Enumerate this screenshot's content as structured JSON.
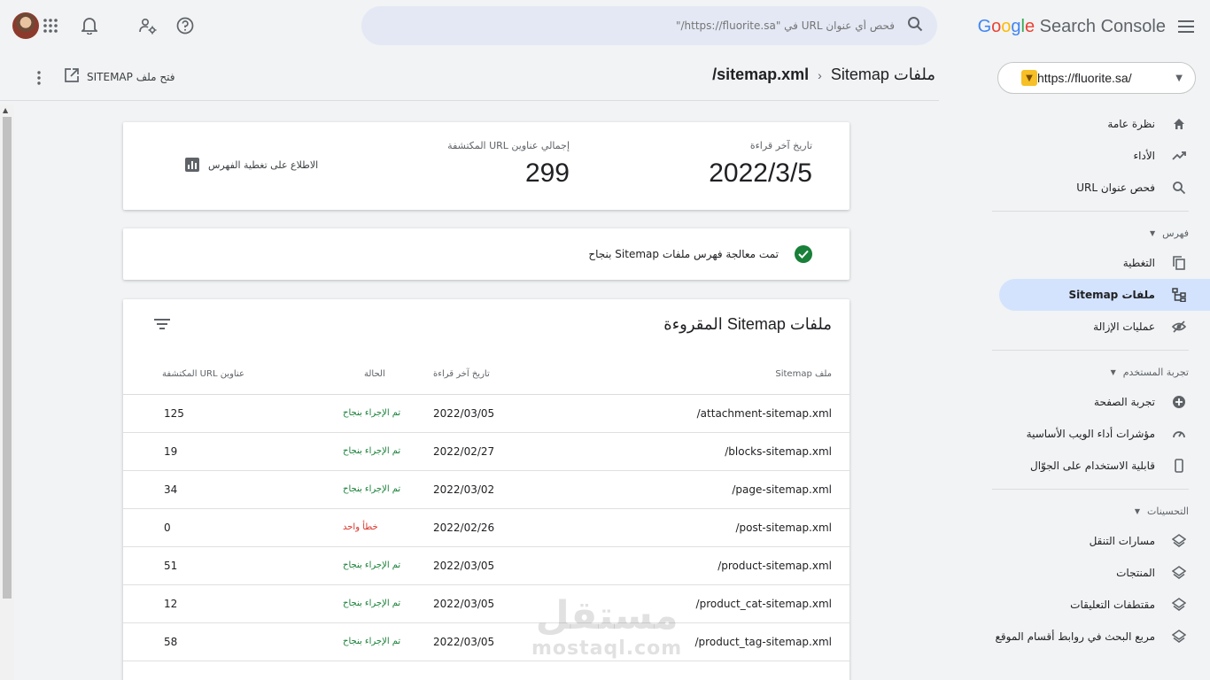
{
  "app": {
    "brand": {
      "G": "G",
      "o1": "o",
      "o2": "o",
      "g": "g",
      "l": "l",
      "e": "e",
      "rest": " Search Console"
    },
    "property_url": "https://fluorite.sa/"
  },
  "search": {
    "placeholder": "فحص أي عنوان URL في \"https://fluorite.sa/\""
  },
  "sidebar": {
    "items_top": [
      {
        "label": "نظرة عامة",
        "icon": "home-icon"
      },
      {
        "label": "الأداء",
        "icon": "trending-icon"
      },
      {
        "label": "فحص عنوان URL",
        "icon": "search-icon"
      }
    ],
    "section_index": "فهرس",
    "items_index": [
      {
        "label": "التغطية",
        "icon": "copy-icon"
      },
      {
        "label": "ملفات Sitemap",
        "icon": "sitemap-icon"
      },
      {
        "label": "عمليات الإزالة",
        "icon": "eye-off-icon"
      }
    ],
    "section_experience": "تجربة المستخدم",
    "items_experience": [
      {
        "label": "تجربة الصفحة",
        "icon": "plus-circle-icon"
      },
      {
        "label": "مؤشرات أداء الويب الأساسية",
        "icon": "gauge-icon"
      },
      {
        "label": "قابلية الاستخدام على الجوّال",
        "icon": "phone-icon"
      }
    ],
    "section_enhancements": "التحسينات",
    "items_enhancements": [
      {
        "label": "مسارات التنقل",
        "icon": "layers-icon"
      },
      {
        "label": "المنتجات",
        "icon": "layers-icon"
      },
      {
        "label": "مقتطفات التعليقات",
        "icon": "layers-icon"
      },
      {
        "label": "مربع البحث في روابط أقسام الموقع",
        "icon": "layers-icon"
      }
    ]
  },
  "header": {
    "breadcrumb_parent": "ملفات Sitemap",
    "breadcrumb_current": "/sitemap.xml",
    "open_sitemap": "فتح ملف SITEMAP"
  },
  "stats": {
    "last_read_label": "تاريخ آخر قراءة",
    "last_read_value": "2022/3/5",
    "total_urls_label": "إجمالي عناوين URL المكتشفة",
    "total_urls_value": "299",
    "coverage_link": "الاطلاع على تغطية الفهرس"
  },
  "status_message": "تمت معالجة فهرس ملفات Sitemap بنجاح",
  "table": {
    "title": "ملفات Sitemap المقروءة",
    "headers": {
      "file": "ملف Sitemap",
      "date": "تاريخ آخر قراءة",
      "status": "الحالة",
      "count": "عناوين URL المكتشفة"
    },
    "rows": [
      {
        "file": "/attachment-sitemap.xml",
        "date": "2022/03/05",
        "status": "تم الإجراء بنجاح",
        "count": "125",
        "ok": true
      },
      {
        "file": "/blocks-sitemap.xml",
        "date": "2022/02/27",
        "status": "تم الإجراء بنجاح",
        "count": "19",
        "ok": true
      },
      {
        "file": "/page-sitemap.xml",
        "date": "2022/03/02",
        "status": "تم الإجراء بنجاح",
        "count": "34",
        "ok": true
      },
      {
        "file": "/post-sitemap.xml",
        "date": "2022/02/26",
        "status": "خطأ واحد",
        "count": "0",
        "ok": false
      },
      {
        "file": "/product-sitemap.xml",
        "date": "2022/03/05",
        "status": "تم الإجراء بنجاح",
        "count": "51",
        "ok": true
      },
      {
        "file": "/product_cat-sitemap.xml",
        "date": "2022/03/05",
        "status": "تم الإجراء بنجاح",
        "count": "12",
        "ok": true
      },
      {
        "file": "/product_tag-sitemap.xml",
        "date": "2022/03/05",
        "status": "تم الإجراء بنجاح",
        "count": "58",
        "ok": true
      }
    ]
  },
  "watermark": {
    "arabic": "مستقل",
    "latin": "mostaql.com"
  },
  "colors": {
    "accent": "#1a73e8",
    "active_bg": "#d3e3fd",
    "success": "#188038",
    "error": "#d93025"
  }
}
